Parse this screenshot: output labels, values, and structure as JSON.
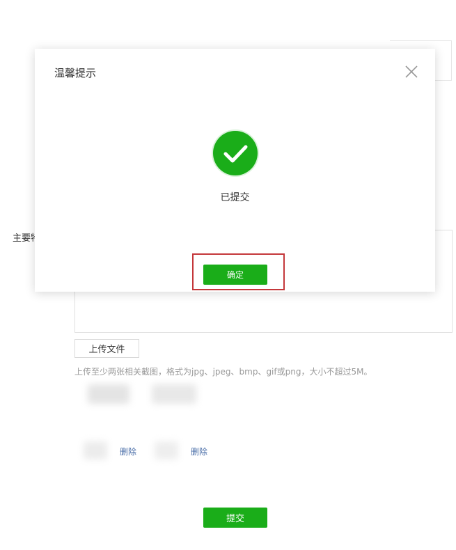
{
  "form": {
    "field_label": "主要特",
    "upload_button_label": "上传文件",
    "upload_hint": "上传至少两张相关截图，格式为jpg、jpeg、bmp、gif或png，大小不超过5M。",
    "attachments": [
      {
        "delete_label": "删除"
      },
      {
        "delete_label": "删除"
      }
    ],
    "submit_button_label": "提交"
  },
  "modal": {
    "title": "温馨提示",
    "message": "已提交",
    "confirm_button_label": "确定",
    "icons": {
      "close": "close-icon",
      "success": "checkmark-circle-icon"
    }
  },
  "colors": {
    "primary_green": "#1aad19",
    "highlight_frame": "#c4373a",
    "link_blue": "#4a6ea8"
  }
}
